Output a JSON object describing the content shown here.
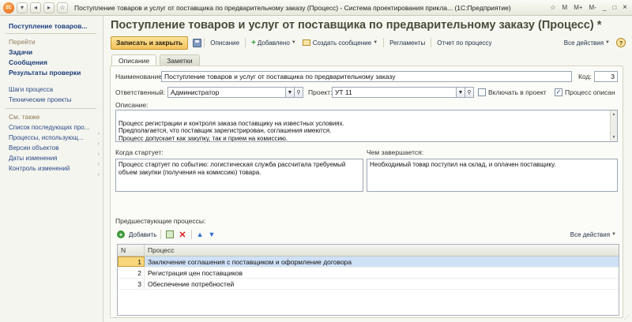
{
  "window": {
    "title": "Поступление товаров и услуг от поставщика по предварительному заказу (Процесс) - Система проектирования прикла... (1С:Предприятие)",
    "controls": [
      "M",
      "M+",
      "M-",
      "_",
      "□",
      "×"
    ]
  },
  "left_panel": {
    "current": "Поступление товаров...",
    "goto_header": "Перейти",
    "bold_items": [
      "Задачи",
      "Сообщения",
      "Результаты проверки"
    ],
    "items": [
      "Шаги процесса",
      "Технические проекты"
    ],
    "see_also_header": "См. также",
    "see_also": [
      "Список последующих про...",
      "Процессы, использующ...",
      "Версии объектов",
      "Даты изменения",
      "Контроль изменений"
    ]
  },
  "form": {
    "title": "Поступление товаров и услуг от поставщика по предварительному заказу (Процесс) *",
    "toolbar": {
      "save_close": "Записать и закрыть",
      "description": "Описание",
      "added": "Добавлено",
      "create_message": "Создать сообщение",
      "regulations": "Регламенты",
      "process_report": "Отчет по процессу",
      "all_actions": "Все действия",
      "help": "?"
    },
    "tabs": [
      "Описание",
      "Заметки"
    ],
    "name_label": "Наименование:",
    "name_value": "Поступление товаров и услуг от поставщика по предварительному заказу",
    "code_label": "Код:",
    "code_value": "3",
    "responsible_label": "Ответственный:",
    "responsible_value": "Администратор",
    "project_label": "Проект:",
    "project_value": "УТ 11",
    "include_label": "Включать в проект",
    "include_checked": false,
    "described_label": "Процесс описан",
    "described_checked": true,
    "description_label": "Описание:",
    "description_text": "Процесс регистрации и контроля заказа поставщику на известных условиях.\nПредполагается, что поставщик зарегистрирован, соглашения имеются.\nПроцесс допускает как закупку, так и прием на комиссию.",
    "when_starts_label": "Когда стартует:",
    "when_starts_text": "Процесс стартует по событию: логистическая служба рассчитала требуемый объем закупки (получения на комиссию) товара.",
    "when_ends_label": "Чем завершается:",
    "when_ends_text": "Необходимый товар поступил на склад, и оплачен поставщику.",
    "prev_label": "Предшествующие процессы:",
    "table_tools": {
      "add": "Добавить",
      "all_actions": "Все действия"
    },
    "table": {
      "columns": [
        "N",
        "Процесс"
      ],
      "rows": [
        {
          "n": "1",
          "process": "Заключение соглашения с поставщиком и оформление договора"
        },
        {
          "n": "2",
          "process": "Регистрация цен поставщиков"
        },
        {
          "n": "3",
          "process": "Обеспечение потребностей"
        }
      ]
    }
  }
}
